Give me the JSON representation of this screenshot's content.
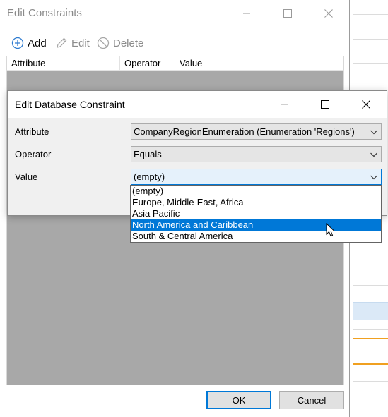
{
  "back_window": {
    "title": "Edit Constraints",
    "toolbar": {
      "add": "Add",
      "edit": "Edit",
      "delete": "Delete"
    },
    "columns": [
      "Attribute",
      "Operator",
      "Value"
    ],
    "ok": "OK",
    "cancel": "Cancel"
  },
  "dialog": {
    "title": "Edit Database Constraint",
    "attribute_label": "Attribute",
    "attribute_value": "CompanyRegionEnumeration (Enumeration 'Regions')",
    "operator_label": "Operator",
    "operator_value": "Equals",
    "value_label": "Value",
    "value_value": "(empty)"
  },
  "dropdown": {
    "options": [
      "(empty)",
      "Europe, Middle-East, Africa",
      "Asia Pacific",
      "North America and Caribbean",
      "South & Central America"
    ],
    "selected_index": 3
  },
  "colors": {
    "accent": "#0078d7",
    "list_background": "#a8a8a8",
    "dialog_background": "#f0f0f0",
    "orange_line": "#f0a020"
  },
  "icons": {
    "add": "plus-circle-icon",
    "edit": "pencil-icon",
    "delete": "prohibit-icon",
    "minimize": "minimize-icon",
    "maximize": "maximize-icon",
    "close": "close-icon",
    "dropdown": "chevron-down-icon",
    "pointer": "mouse-pointer-icon"
  }
}
